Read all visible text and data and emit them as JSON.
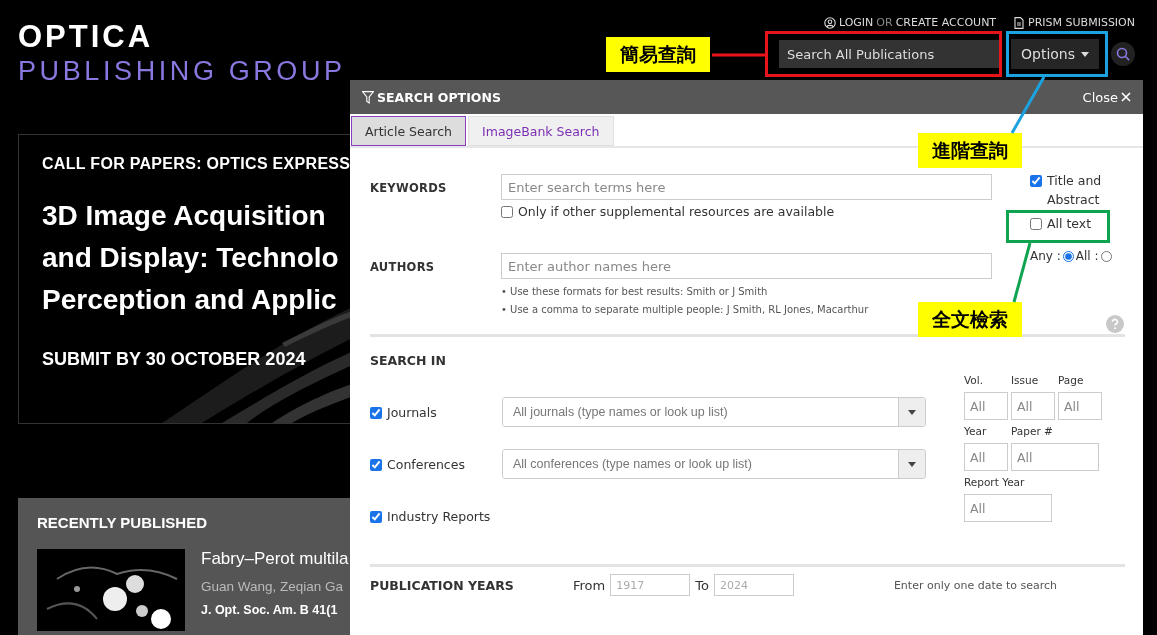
{
  "header": {
    "logo_top": "OPTICA",
    "logo_bottom": "PUBLISHING GROUP",
    "login": "LOGIN",
    "or": "OR",
    "create_account": "CREATE ACCOUNT",
    "prism": "PRISM SUBMISSION",
    "search_placeholder": "Search All Publications",
    "options": "Options"
  },
  "feature": {
    "eyebrow": "CALL FOR PAPERS: OPTICS EXPRESS",
    "title_lines": [
      "3D Image Acquisition",
      "and Display: Technolo",
      "Perception and Applic"
    ],
    "deadline": "SUBMIT BY 30 OCTOBER 2024"
  },
  "recent": {
    "heading": "RECENTLY PUBLISHED",
    "title": "Fabry–Perot multila",
    "authors": "Guan Wang, Zeqian Ga",
    "citation": "J. Opt. Soc. Am. B 41(1"
  },
  "dialog": {
    "title": "SEARCH OPTIONS",
    "close": "Close",
    "tabs": [
      {
        "label": "Article Search",
        "selected": true
      },
      {
        "label": "ImageBank Search",
        "selected": false
      }
    ],
    "keywords": {
      "label": "KEYWORDS",
      "placeholder": "Enter search terms here",
      "supplemental": {
        "label": "Only if other supplemental resources are available",
        "checked": false
      }
    },
    "scope": [
      {
        "label": "Title and Abstract",
        "checked": true
      },
      {
        "label": "All text",
        "checked": false
      }
    ],
    "match": [
      {
        "label": "Any :",
        "selected": true
      },
      {
        "label": "All :",
        "selected": false
      }
    ],
    "authors": {
      "label": "AUTHORS",
      "placeholder": "Enter author names here",
      "hints": [
        "• Use these formats for best results: Smith or J Smith",
        "• Use a comma to separate multiple people: J Smith, RL Jones, Macarthur"
      ]
    },
    "search_in": {
      "heading": "SEARCH IN",
      "sources": [
        {
          "kind": "select",
          "label": "Journals",
          "checked": true,
          "placeholder": "All journals (type names or look up list)"
        },
        {
          "kind": "select",
          "label": "Conferences",
          "checked": true,
          "placeholder": "All conferences (type names or look up list)"
        },
        {
          "kind": "plain",
          "label": "Industry Reports",
          "checked": true
        }
      ]
    },
    "filters": [
      [
        {
          "label": "Vol.",
          "placeholder": "All"
        },
        {
          "label": "Issue",
          "placeholder": "All"
        },
        {
          "label": "Page",
          "placeholder": "All"
        }
      ],
      [
        {
          "label": "Year",
          "placeholder": "All"
        },
        {
          "label": "Paper #",
          "placeholder": "All",
          "wide": true
        }
      ],
      [
        {
          "label": "Report Year",
          "placeholder": "All",
          "wide": true
        }
      ]
    ],
    "years": {
      "heading": "PUBLICATION YEARS",
      "from_label": "From",
      "from_placeholder": "1917",
      "to_label": "To",
      "to_placeholder": "2024",
      "note": "Enter only one date to search"
    }
  },
  "callouts": [
    {
      "text": "簡易查詢",
      "color": "#e8141b"
    },
    {
      "text": "進階查詢",
      "color": "#1aa3e0"
    },
    {
      "text": "全文檢索",
      "color": "#0ea44f"
    }
  ]
}
